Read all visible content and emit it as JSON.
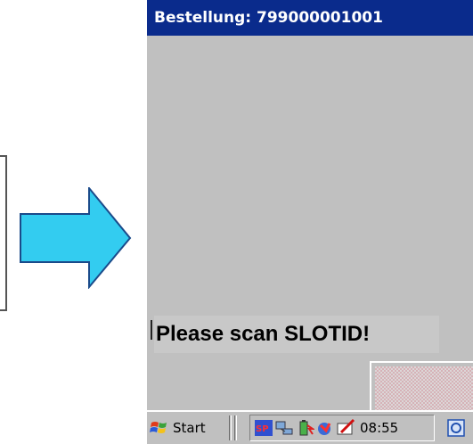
{
  "window": {
    "title": "Bestellung: 799000001001"
  },
  "content": {
    "prompt": "Please scan SLOTID!"
  },
  "taskbar": {
    "start_label": "Start",
    "clock": "08:55",
    "tray_icons": [
      "sap-icon",
      "network-icon",
      "battery-icon",
      "connection-icon",
      "pen-input-icon"
    ]
  },
  "colors": {
    "titlebar": "#0a2b8c",
    "arrow_fill": "#33ccf0",
    "background": "#c0c0c0"
  }
}
